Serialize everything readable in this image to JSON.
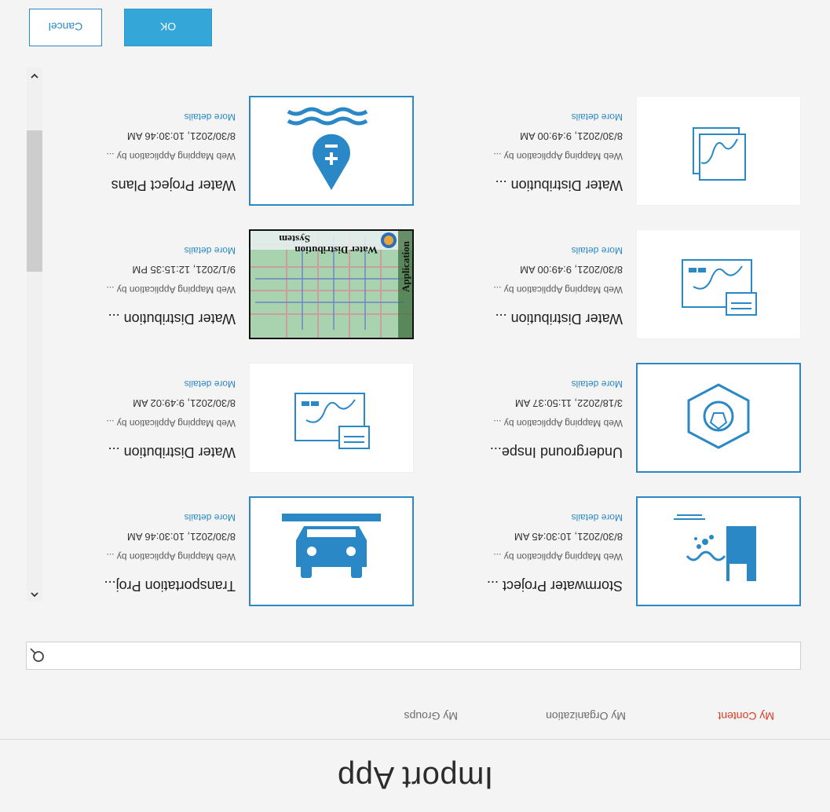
{
  "dialog": {
    "title": "Import App",
    "tabs": [
      {
        "label": "My Content",
        "active": true
      },
      {
        "label": "My Organization",
        "active": false
      },
      {
        "label": "My Groups",
        "active": false
      }
    ]
  },
  "search": {
    "placeholder": ""
  },
  "cards": [
    {
      "title": "Stormwater Project ...",
      "type": "Web Mapping Application by ...",
      "date": "8/30/2021, 10:30:45 AM",
      "more": "More details",
      "selected": true,
      "icon": "stormwater-thumbnail-icon"
    },
    {
      "title": "Transportation Proj...",
      "type": "Web Mapping Application by ...",
      "date": "8/30/2021, 10:30:46 AM",
      "more": "More details",
      "selected": true,
      "icon": "car-icon"
    },
    {
      "title": "Underground Inspe...",
      "type": "Web Mapping Application by ...",
      "date": "3/18/2022, 11:50:37 AM",
      "more": "More details",
      "selected": true,
      "icon": "experience-builder-icon"
    },
    {
      "title": "Water Distribution ...",
      "type": "Web Mapping Application by ...",
      "date": "8/30/2021, 9:49:02 AM",
      "more": "More details",
      "selected": false,
      "icon": "map-document-icon"
    },
    {
      "title": "Water Distribution ...",
      "type": "Web Mapping Application by ...",
      "date": "8/30/2021, 9:49:00 AM",
      "more": "More details",
      "selected": false,
      "icon": "map-document-icon"
    },
    {
      "title": "Water Distribution ...",
      "type": "Web Mapping Application by ...",
      "date": "9/1/2021, 12:15:35 PM",
      "more": "More details",
      "selected": false,
      "icon": "water-distribution-map-thumbnail",
      "thumb_text": [
        "Water Distribution",
        "System",
        "Application"
      ]
    },
    {
      "title": "Water Distribution ...",
      "type": "Web Mapping Application by ...",
      "date": "8/30/2021, 9:49:00 AM",
      "more": "More details",
      "selected": false,
      "icon": "map-layers-icon"
    },
    {
      "title": "Water Project Plans",
      "type": "Web Mapping Application by ...",
      "date": "8/30/2021, 10:30:46 AM",
      "more": "More details",
      "selected": true,
      "icon": "water-plus-pin-icon"
    }
  ],
  "buttons": {
    "ok": "OK",
    "cancel": "Cancel"
  },
  "colors": {
    "accent": "#2a88c6",
    "active_tab": "#d93b1f",
    "ok_button": "#35a6d8"
  }
}
